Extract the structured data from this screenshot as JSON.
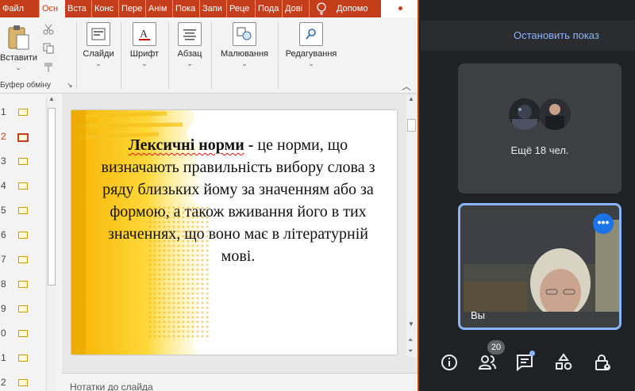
{
  "ppt": {
    "tabs": [
      "Файл",
      "Осн",
      "Вста",
      "Конс",
      "Пере",
      "Анім",
      "Пока",
      "Запи",
      "Реце",
      "Пода",
      "Дові"
    ],
    "tell_me": "Допомо",
    "ribbon": {
      "paste_label": "Вставити",
      "clipboard_group": "Буфер обміну",
      "slides_label": "Слайди",
      "font_label": "Шрифт",
      "paragraph_label": "Абзац",
      "drawing_label": "Малювання",
      "editing_label": "Редагування"
    },
    "thumbnails": [
      "1",
      "2",
      "3",
      "4",
      "5",
      "6",
      "7",
      "8",
      "9",
      "0",
      "1",
      "2"
    ],
    "selected_thumbnail_index": 1,
    "slide": {
      "term": "Лексичні норми",
      "dash": " - ",
      "definition_1": "це норми, що визначають правильність вибору слова з ряду близьких йому за значенням або за формою, а також вживання його в тих значеннях, що воно має в літературній мові."
    },
    "notes_label": "Нотатки до слайда"
  },
  "meet": {
    "stop_sharing": "Остановить показ",
    "more_people": "Ещё 18 чел.",
    "self_name": "Вы",
    "people_count": "20",
    "menu_dots": "•••",
    "accent_color": "#8ab4f8"
  }
}
